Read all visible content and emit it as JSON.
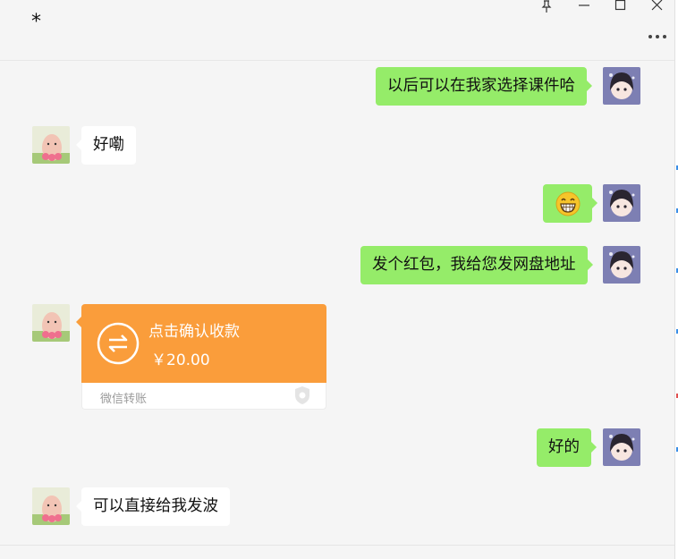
{
  "header": {
    "title": "*"
  },
  "messages": [
    {
      "from": "me",
      "text": "以后可以在我家选择课件哈"
    },
    {
      "from": "them",
      "text": "好嘞"
    },
    {
      "from": "me",
      "emoji": "grinning-face-emoji"
    },
    {
      "from": "me",
      "text": "发个红包，我给您发网盘地址"
    },
    {
      "from": "them",
      "transfer": {
        "title": "点击确认收款",
        "amount": "￥20.00",
        "label": "微信转账"
      }
    },
    {
      "from": "me",
      "text": "好的"
    },
    {
      "from": "them",
      "text": "可以直接给我发波"
    }
  ],
  "colors": {
    "background": "#f5f5f5",
    "my_bubble": "#95ec69",
    "their_bubble": "#ffffff",
    "transfer": "#fa9d3b"
  },
  "icons": [
    "pin-icon",
    "minimize-icon",
    "maximize-icon",
    "close-icon",
    "more-icon",
    "transfer-arrows-icon",
    "shield-icon"
  ]
}
